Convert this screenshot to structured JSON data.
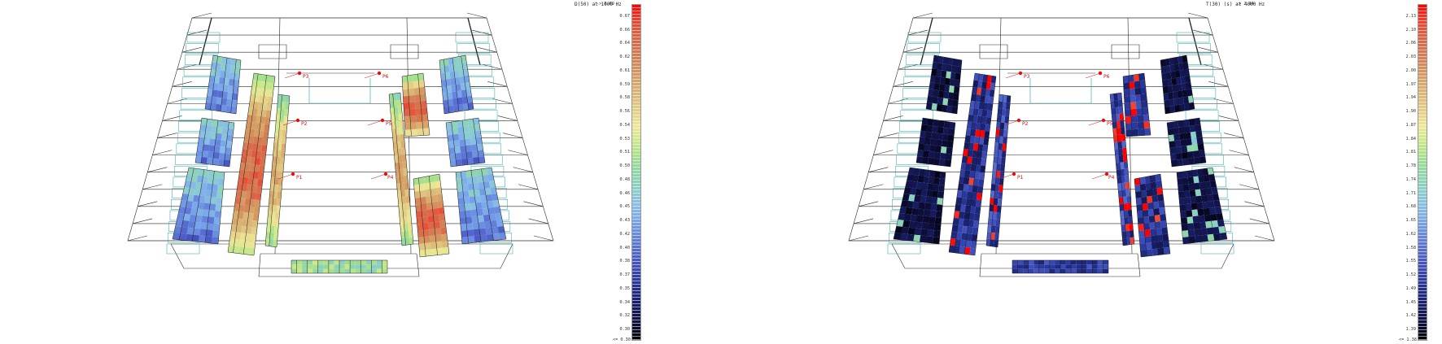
{
  "left": {
    "title": "D(50)  at 1000 Hz",
    "max_label": "-> 0.69",
    "min_label": "<= 0.30",
    "ticks": [
      "0.67",
      "0.66",
      "0.64",
      "0.62",
      "0.61",
      "0.59",
      "0.58",
      "0.56",
      "0.54",
      "0.53",
      "0.51",
      "0.50",
      "0.48",
      "0.46",
      "0.45",
      "0.43",
      "0.42",
      "0.40",
      "0.38",
      "0.37",
      "0.35",
      "0.34",
      "0.32",
      "0.30"
    ],
    "points": [
      "P3",
      "P6",
      "P2",
      "P5",
      "P1",
      "P4"
    ],
    "colormap": [
      "#ff0000",
      "#ee3c2a",
      "#e25a3e",
      "#d86d4a",
      "#d48055",
      "#d5955f",
      "#d8aa6c",
      "#dcbd79",
      "#e4d087",
      "#eee596",
      "#cfe98a",
      "#aee28a",
      "#95d99a",
      "#8ed4b4",
      "#8acdd0",
      "#88bde6",
      "#7aa8ea",
      "#6a8ce0",
      "#5a72d3",
      "#4a5ac4",
      "#3544ad",
      "#243291",
      "#1a2373",
      "#121652",
      "#0a0a33",
      "#000000"
    ]
  },
  "right": {
    "title": "T(30) (s)  at 4000 Hz",
    "max_label": "-> 2.14",
    "min_label": "<= 1.38",
    "ticks": [
      "2.13",
      "2.10",
      "2.06",
      "2.03",
      "2.00",
      "1.97",
      "1.94",
      "1.90",
      "1.87",
      "1.84",
      "1.81",
      "1.78",
      "1.74",
      "1.71",
      "1.68",
      "1.65",
      "1.62",
      "1.58",
      "1.55",
      "1.52",
      "1.49",
      "1.45",
      "1.42",
      "1.39"
    ],
    "points": [
      "P3",
      "P6",
      "P2",
      "P5",
      "P1",
      "P4"
    ],
    "colormap": [
      "#ff0000",
      "#ee3c2a",
      "#e25a3e",
      "#d86d4a",
      "#d48055",
      "#d5955f",
      "#d8aa6c",
      "#dcbd79",
      "#e4d087",
      "#eee596",
      "#cfe98a",
      "#aee28a",
      "#95d99a",
      "#8ed4b4",
      "#8acdd0",
      "#88bde6",
      "#7aa8ea",
      "#6a8ce0",
      "#5a72d3",
      "#4a5ac4",
      "#3544ad",
      "#243291",
      "#1a2373",
      "#121652",
      "#0a0a33",
      "#000000"
    ]
  }
}
